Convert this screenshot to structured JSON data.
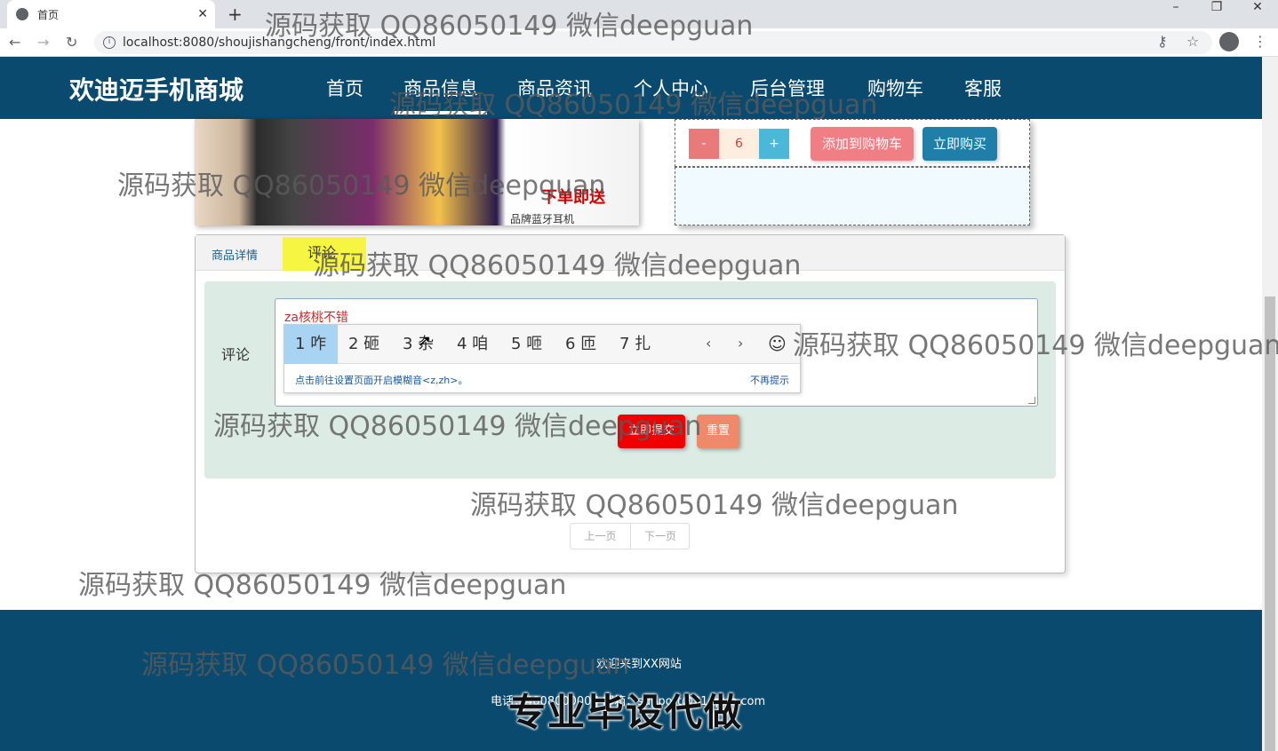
{
  "browser": {
    "tab_title": "首页",
    "url": "localhost:8080/shoujishangcheng/front/index.html",
    "win_minimize": "–",
    "win_restore": "❐",
    "win_close": "✕"
  },
  "header": {
    "logo": "欢迪迈手机商城",
    "nav": [
      "首页",
      "商品信息",
      "商品资讯",
      "个人中心",
      "后台管理",
      "购物车",
      "客服"
    ],
    "active_index": 1
  },
  "product": {
    "promo_text": "下单即送",
    "promo_sub": "品牌蓝牙耳机"
  },
  "purchase": {
    "minus": "-",
    "quantity": "6",
    "plus": "+",
    "add_to_cart": "添加到购物车",
    "buy_now": "立即购买"
  },
  "detail": {
    "tabs": [
      "商品详情",
      "评论"
    ],
    "active_tab": "评论",
    "comment_label": "评论",
    "comment_value": "za核桃不错",
    "ime": {
      "candidates": [
        "1 咋",
        "2 砸",
        "3 杂",
        "4 咱",
        "5 咂",
        "6 匝",
        "7 扎"
      ],
      "selected": 0,
      "prev": "‹",
      "next": "›",
      "emoji": "☺",
      "hint": "点击前往设置页面开启模糊音<z,zh>。",
      "dismiss": "不再提示"
    },
    "submit": "立即提交",
    "reset": "重置",
    "pager": {
      "prev": "上一页",
      "next": "下一页"
    }
  },
  "footer": {
    "welcome": "欢迎来到XX网站",
    "contact": "电话：400800000 | 邮箱：support@21epub.com",
    "slogan": "专业毕设代做"
  },
  "watermark": "源码获取 QQ86050149 微信deepguan"
}
